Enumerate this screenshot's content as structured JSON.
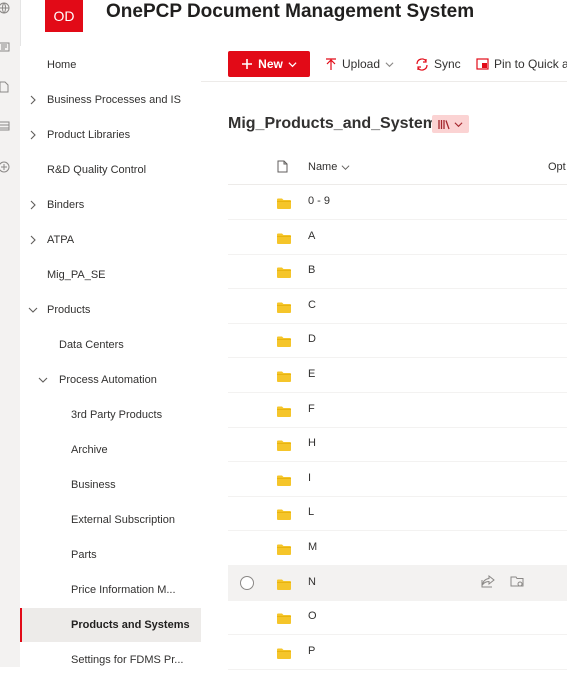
{
  "header": {
    "logo_text": "OD",
    "site_title": "OnePCP Document Management System"
  },
  "rail": {
    "icons": [
      "globe-icon",
      "news-icon",
      "files-icon",
      "lists-icon",
      "add-icon"
    ]
  },
  "nav": {
    "items": [
      {
        "label": "Home",
        "level": 0,
        "chevron": "none",
        "selected": false
      },
      {
        "label": "Business Processes and IS",
        "level": 0,
        "chevron": "right",
        "selected": false
      },
      {
        "label": "Product Libraries",
        "level": 0,
        "chevron": "right",
        "selected": false
      },
      {
        "label": "R&D Quality Control",
        "level": 0,
        "chevron": "none",
        "selected": false
      },
      {
        "label": "Binders",
        "level": 0,
        "chevron": "right",
        "selected": false
      },
      {
        "label": "ATPA",
        "level": 0,
        "chevron": "right",
        "selected": false
      },
      {
        "label": "Mig_PA_SE",
        "level": 0,
        "chevron": "none",
        "selected": false
      },
      {
        "label": "Products",
        "level": 0,
        "chevron": "down",
        "selected": false
      },
      {
        "label": "Data Centers",
        "level": 1,
        "chevron": "none",
        "selected": false
      },
      {
        "label": "Process Automation",
        "level": 1,
        "chevron": "down",
        "selected": false
      },
      {
        "label": "3rd Party Products",
        "level": 2,
        "chevron": "none",
        "selected": false
      },
      {
        "label": "Archive",
        "level": 2,
        "chevron": "none",
        "selected": false
      },
      {
        "label": "Business",
        "level": 2,
        "chevron": "none",
        "selected": false
      },
      {
        "label": "External Subscription",
        "level": 2,
        "chevron": "none",
        "selected": false
      },
      {
        "label": "Parts",
        "level": 2,
        "chevron": "none",
        "selected": false
      },
      {
        "label": "Price Information M...",
        "level": 2,
        "chevron": "none",
        "selected": false
      },
      {
        "label": "Products and Systems",
        "level": 2,
        "chevron": "none",
        "selected": true
      },
      {
        "label": "Settings for FDMS Pr...",
        "level": 2,
        "chevron": "none",
        "selected": false
      }
    ]
  },
  "commandbar": {
    "new_label": "New",
    "upload_label": "Upload",
    "sync_label": "Sync",
    "pin_label": "Pin to Quick ac"
  },
  "library": {
    "title": "Mig_Products_and_Systems",
    "view_icon": "library-icon",
    "columns": {
      "name": "Name",
      "other": "Opt"
    },
    "rows": [
      {
        "name": "0 - 9",
        "hover": false
      },
      {
        "name": "A",
        "hover": false
      },
      {
        "name": "B",
        "hover": false
      },
      {
        "name": "C",
        "hover": false
      },
      {
        "name": "D",
        "hover": false
      },
      {
        "name": "E",
        "hover": false
      },
      {
        "name": "F",
        "hover": false
      },
      {
        "name": "H",
        "hover": false
      },
      {
        "name": "I",
        "hover": false
      },
      {
        "name": "L",
        "hover": false
      },
      {
        "name": "M",
        "hover": false
      },
      {
        "name": "N",
        "hover": true
      },
      {
        "name": "O",
        "hover": false
      },
      {
        "name": "P",
        "hover": false
      }
    ]
  },
  "colors": {
    "accent": "#e20a17",
    "folder": "#f5c52a",
    "hover": "#f3f2f1"
  }
}
